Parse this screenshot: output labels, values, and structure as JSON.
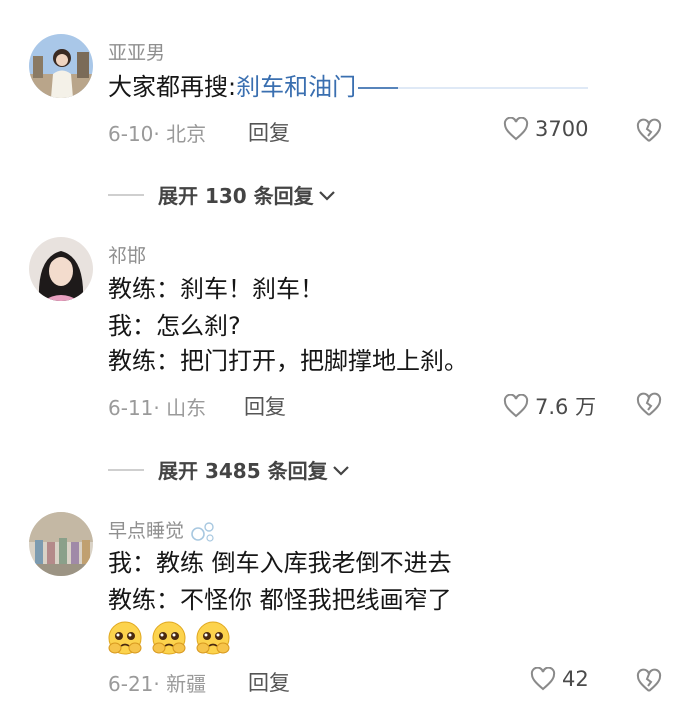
{
  "comments": [
    {
      "username": "亚亚男",
      "lines": [
        "大家都再搜:"
      ],
      "link_text": "刹车和油门",
      "date_location": "6-10· 北京",
      "reply_label": "回复",
      "likes": "3700",
      "expand_label": "展开 130 条回复"
    },
    {
      "username": "祁邯",
      "lines": [
        "教练：刹车！刹车！",
        "我：怎么刹?",
        "教练：把门打开，把脚撑地上刹。"
      ],
      "date_location": "6-11· 山东",
      "reply_label": "回复",
      "likes": "7.6 万",
      "expand_label": "展开 3485 条回复"
    },
    {
      "username": "早点睡觉",
      "lines": [
        "我：教练 倒车入库我老倒不进去",
        "教练：不怪你 都怪我把线画窄了"
      ],
      "emojis": [
        "pleading-face-emoji",
        "pleading-face-emoji",
        "pleading-face-emoji"
      ],
      "date_location": "6-21· 新疆",
      "reply_label": "回复",
      "likes": "42"
    }
  ],
  "colors": {
    "link": "#3a6fb0",
    "meta": "#9a9a9a",
    "username": "#8f8f8f"
  }
}
